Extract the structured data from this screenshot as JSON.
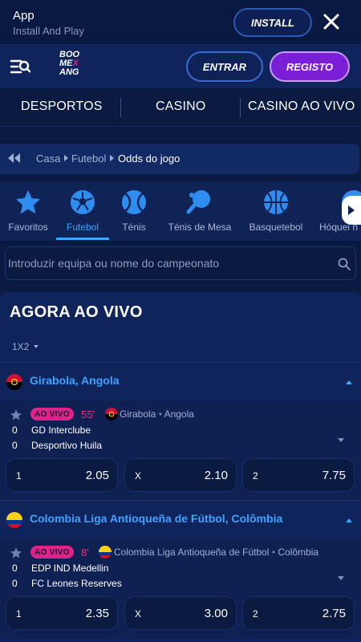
{
  "banner": {
    "title": "App",
    "subtitle": "Install And Play",
    "install_label": "INSTALL"
  },
  "header": {
    "logo_line1": "BOO",
    "logo_line2a": "ME",
    "logo_x": "X",
    "logo_line3": "ANG",
    "entrar_label": "ENTRAR",
    "registo_label": "REGISTO"
  },
  "nav": {
    "items": [
      "DESPORTOS",
      "CASINO",
      "CASINO AO VIVO"
    ]
  },
  "breadcrumb": {
    "items": [
      "Casa",
      "Futebol",
      "Odds do jogo"
    ]
  },
  "sports": [
    {
      "label": "Favoritos",
      "icon": "star-icon"
    },
    {
      "label": "Futebol",
      "icon": "football-icon",
      "active": true
    },
    {
      "label": "Ténis",
      "icon": "tennis-icon"
    },
    {
      "label": "Ténis de Mesa",
      "icon": "table-tennis-icon"
    },
    {
      "label": "Basquetebol",
      "icon": "basketball-icon"
    },
    {
      "label": "Hóquei n",
      "icon": "hockey-icon"
    }
  ],
  "search": {
    "placeholder": "Introduzir equipa ou nome do campeonato"
  },
  "live": {
    "title": "AGORA AO VIVO",
    "market": "1X2",
    "leagues": [
      {
        "name": "Girabola, Angola",
        "match": {
          "badge": "AO VIVO",
          "minute": "55'",
          "league": "Girabola",
          "country": "Angola",
          "home": {
            "score": "0",
            "name": "GD Interclube"
          },
          "away": {
            "score": "0",
            "name": "Desportivo Huila"
          },
          "odds": [
            {
              "label": "1",
              "value": "2.05"
            },
            {
              "label": "X",
              "value": "2.10"
            },
            {
              "label": "2",
              "value": "7.75"
            }
          ]
        }
      },
      {
        "name": "Colombia Liga Antioqueña de Fútbol, Colômbia",
        "match": {
          "badge": "AO VIVO",
          "minute": "8'",
          "league": "Colombia Liga Antioqueña de Fútbol",
          "country": "Colômbia",
          "home": {
            "score": "0",
            "name": "EDP IND Medellin"
          },
          "away": {
            "score": "0",
            "name": "FC Leones Reserves"
          },
          "odds": [
            {
              "label": "1",
              "value": "2.35"
            },
            {
              "label": "X",
              "value": "3.00"
            },
            {
              "label": "2",
              "value": "2.75"
            }
          ]
        }
      }
    ]
  },
  "colors": {
    "accent": "#3fa3ff",
    "live": "#e0238a",
    "registo": "#7b1fd6",
    "background": "#0b1a40"
  }
}
